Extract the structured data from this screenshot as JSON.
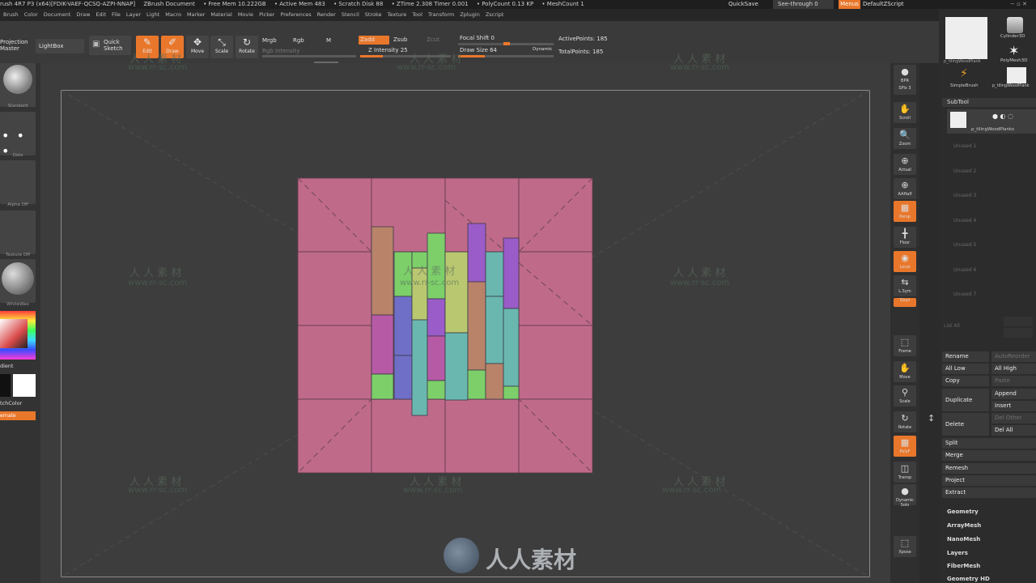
{
  "titlebar": {
    "app": "rush 4R7 P3 (x64)[FDIK-VAEF-QCSQ-AZPI-NNAP]",
    "doc": "ZBrush Document",
    "free_mem": "• Free Mem 10.222GB",
    "active_mem": "• Active Mem 483",
    "scratch": "• Scratch Disk 88",
    "ztime": "• ZTime 2.308 Timer 0.001",
    "polycount": "• PolyCount 0.13 KP",
    "meshcount": "• MeshCount 1",
    "quicksave": "QuickSave",
    "see_through": "See-through 0",
    "menus": "Menus",
    "default_script": "DefaultZScript"
  },
  "menubar": [
    "Brush",
    "Color",
    "Document",
    "Draw",
    "Edit",
    "File",
    "Layer",
    "Light",
    "Macro",
    "Marker",
    "Material",
    "Movie",
    "Picker",
    "Preferences",
    "Render",
    "Stencil",
    "Stroke",
    "Texture",
    "Tool",
    "Transform",
    "Zplugin",
    "Zscript"
  ],
  "toolbar": {
    "projection_master": "Projection Master",
    "lightbox": "LightBox",
    "quick_sketch": "Quick Sketch",
    "edit": "Edit",
    "draw": "Draw",
    "move": "Move",
    "scale": "Scale",
    "rotate": "Rotate",
    "mrgb": "Mrgb",
    "rgb": "Rgb",
    "m": "M",
    "rgb_intensity": "Rgb Intensity",
    "zadd": "Zadd",
    "zsub": "Zsub",
    "zcut": "Zcut",
    "z_intensity": "Z Intensity 25",
    "z_intensity_value": 25,
    "focal_shift": "Focal Shift 0",
    "draw_size": "Draw Size 64",
    "dynamic": "Dynamic",
    "active_points": "ActivePoints: 185",
    "total_points": "TotalPoints: 185"
  },
  "leftshelf": {
    "brush": "Standard",
    "stroke": "Dots",
    "alpha": "Alpha Off",
    "texture": "Texture Off",
    "material": "WhiteWax",
    "gradient": "dient",
    "switch_color": "tchColor",
    "alternate": "ernate"
  },
  "rightshelf": [
    "BPR",
    "SPix 3",
    "Scroll",
    "Zoom",
    "Actual",
    "AAHalf",
    "Persp",
    "Floor",
    "Local",
    "L.Sym",
    "Qxyz",
    "Frame",
    "Move",
    "Scale",
    "Rotate",
    "PolyF",
    "Transp",
    "Dynamic Solo",
    "Xpose"
  ],
  "tray": {
    "tools": [
      "p_tilingWoodPlank",
      "Cylinder3D",
      "PolyMesh3D",
      "SimpleBrush",
      "p_tilingWoodPlank"
    ],
    "subtool_header": "SubTool",
    "active_subtool": "p_tilingWoodPlanks",
    "unused_slots": [
      "Unused 1",
      "Unused 2",
      "Unused 3",
      "Unused 4",
      "Unused 5",
      "Unused 6",
      "Unused 7"
    ],
    "list_all": "List All",
    "rename": "Rename",
    "auto_reorder": "AutoReorder",
    "all_low": "All Low",
    "all_high": "All High",
    "copy": "Copy",
    "paste": "Paste",
    "append": "Append",
    "duplicate": "Duplicate",
    "insert": "Insert",
    "delete": "Delete",
    "del_other": "Del Other",
    "del_all": "Del All",
    "split": "Split",
    "merge": "Merge",
    "remesh": "Remesh",
    "project": "Project",
    "extract": "Extract",
    "menus": [
      "Geometry",
      "ArrayMesh",
      "NanoMesh",
      "Layers",
      "FiberMesh",
      "Geometry HD"
    ]
  },
  "watermark": {
    "cn": "人人素材",
    "cn_short": "人 人 素 材",
    "url": "www.rr-sc.com"
  },
  "colors": {
    "accent": "#e9772b",
    "mesh_base": "#c06a8a",
    "plank_green": "#7dcf6a",
    "plank_blue": "#6f6fc8",
    "plank_teal": "#6ab7b0",
    "plank_purple": "#9a5cc8",
    "plank_brown": "#b9836a",
    "plank_yellow": "#b9c870",
    "plank_magenta": "#b65aa6"
  }
}
